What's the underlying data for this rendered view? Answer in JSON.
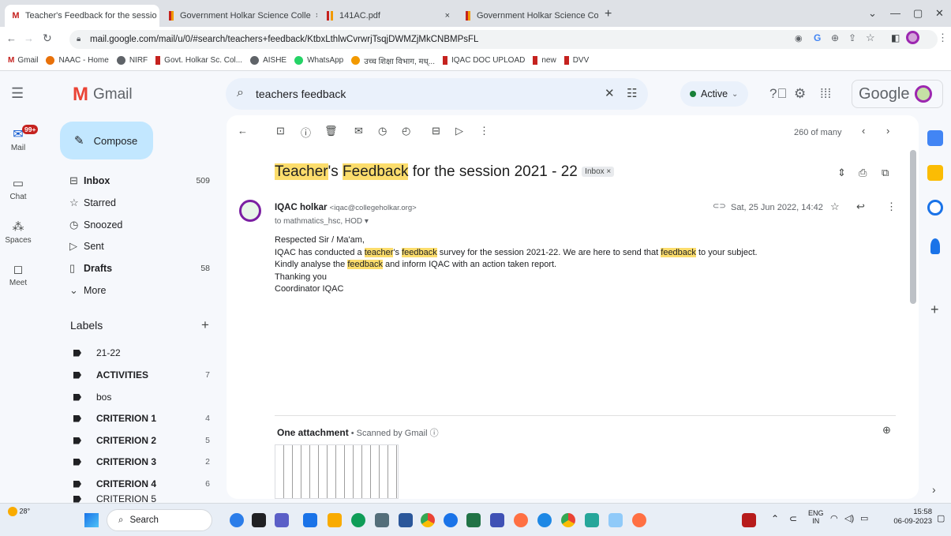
{
  "tabs": [
    {
      "title": "Teacher's Feedback for the sessio",
      "close": "×"
    },
    {
      "title": "Government Holkar Science Colle",
      "close": "×"
    },
    {
      "title": "141AC.pdf",
      "close": "×"
    },
    {
      "title": "Government Holkar Science Colle",
      "close": "×"
    }
  ],
  "new_tab": "+",
  "url": "mail.google.com/mail/u/0/#search/teachers+feedback/KtbxLthlwCvrwrjTsqjDWMZjMkCNBMPsFL",
  "bookmarks": [
    "Gmail",
    "NAAC - Home",
    "NIRF",
    "Govt. Holkar Sc. Col...",
    "AISHE",
    "WhatsApp",
    "उच्च शिक्षा विभाग, मध्...",
    "IQAC DOC UPLOAD",
    "new",
    "DVV"
  ],
  "gmail": {
    "logo_text": "Gmail",
    "compose": "Compose",
    "search_query": "teachers feedback",
    "status": "Active",
    "google": "Google"
  },
  "rail": [
    {
      "label": "Mail",
      "badge": "99+"
    },
    {
      "label": "Chat"
    },
    {
      "label": "Spaces"
    },
    {
      "label": "Meet"
    }
  ],
  "nav": [
    {
      "label": "Inbox",
      "count": "509",
      "bold": true
    },
    {
      "label": "Starred",
      "count": ""
    },
    {
      "label": "Snoozed",
      "count": ""
    },
    {
      "label": "Sent",
      "count": ""
    },
    {
      "label": "Drafts",
      "count": "58",
      "bold": true
    },
    {
      "label": "More",
      "count": ""
    }
  ],
  "labels_heading": "Labels",
  "labels": [
    {
      "name": "21-22",
      "count": ""
    },
    {
      "name": "ACTIVITIES",
      "count": "7"
    },
    {
      "name": "bos",
      "count": ""
    },
    {
      "name": "CRITERION 1",
      "count": "4"
    },
    {
      "name": "CRITERION 2",
      "count": "5"
    },
    {
      "name": "CRITERION 3",
      "count": "2"
    },
    {
      "name": "CRITERION 4",
      "count": "6"
    },
    {
      "name": "CRITERION 5",
      "count": ""
    }
  ],
  "pagination": "260 of many",
  "email": {
    "subject_p1": "Teacher",
    "subject_p2": "'s ",
    "subject_p3": "Feedback",
    "subject_p4": " for the session 2021 - 22",
    "chip": "Inbox ×",
    "sender_name": "IQAC holkar",
    "sender_email": "<iqac@collegeholkar.org>",
    "to": "to mathmatics_hsc, HOD ▾",
    "date": "Sat, 25 Jun 2022, 14:42",
    "greeting": "Respected Sir / Ma'am,",
    "line1_a": "IQAC has conducted a ",
    "line1_hl1": "teacher",
    "line1_b": "'s ",
    "line1_hl2": "feedback",
    "line1_c": " survey for the session 2021-22. We are here to send that ",
    "line1_hl3": "feedback",
    "line1_d": " to your subject.",
    "line2_a": "Kindly analyse the ",
    "line2_hl": "feedback",
    "line2_b": " and inform IQAC with an action taken report.",
    "line3": "Thanking you",
    "line4": "Coordinator IQAC",
    "attach_title": "One attachment",
    "attach_scan": " • Scanned by Gmail ⓘ"
  },
  "taskbar": {
    "weather": "28°",
    "search": "Search",
    "lang1": "ENG",
    "lang2": "IN",
    "time": "15:58",
    "date": "06-09-2023"
  }
}
